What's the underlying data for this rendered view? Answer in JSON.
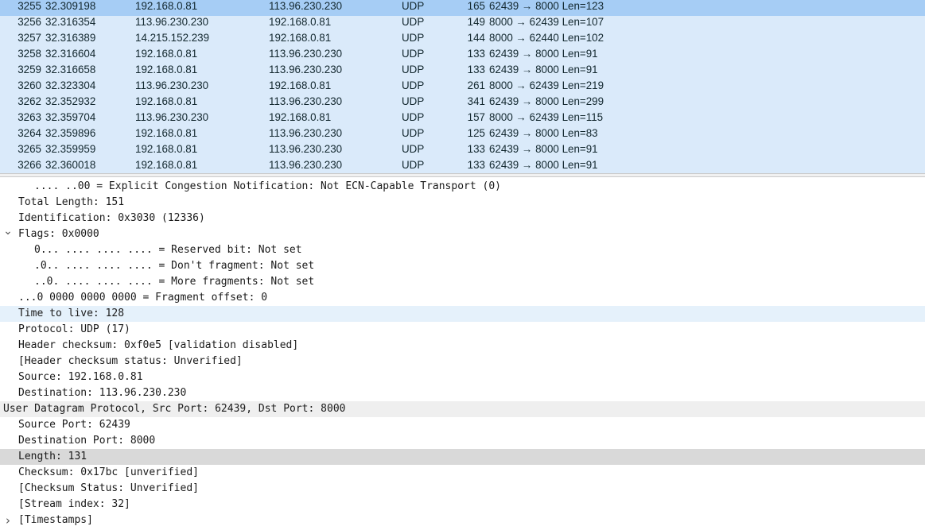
{
  "packet_list": {
    "rows": [
      {
        "no": "3255",
        "time": "32.309198",
        "src": "192.168.0.81",
        "dst": "113.96.230.230",
        "proto": "UDP",
        "len": "165",
        "info": "62439 → 8000 Len=123",
        "selected": true
      },
      {
        "no": "3256",
        "time": "32.316354",
        "src": "113.96.230.230",
        "dst": "192.168.0.81",
        "proto": "UDP",
        "len": "149",
        "info": "8000 → 62439 Len=107",
        "selected": false
      },
      {
        "no": "3257",
        "time": "32.316389",
        "src": "14.215.152.239",
        "dst": "192.168.0.81",
        "proto": "UDP",
        "len": "144",
        "info": "8000 → 62440 Len=102",
        "selected": false
      },
      {
        "no": "3258",
        "time": "32.316604",
        "src": "192.168.0.81",
        "dst": "113.96.230.230",
        "proto": "UDP",
        "len": "133",
        "info": "62439 → 8000 Len=91",
        "selected": false
      },
      {
        "no": "3259",
        "time": "32.316658",
        "src": "192.168.0.81",
        "dst": "113.96.230.230",
        "proto": "UDP",
        "len": "133",
        "info": "62439 → 8000 Len=91",
        "selected": false
      },
      {
        "no": "3260",
        "time": "32.323304",
        "src": "113.96.230.230",
        "dst": "192.168.0.81",
        "proto": "UDP",
        "len": "261",
        "info": "8000 → 62439 Len=219",
        "selected": false
      },
      {
        "no": "3262",
        "time": "32.352932",
        "src": "192.168.0.81",
        "dst": "113.96.230.230",
        "proto": "UDP",
        "len": "341",
        "info": "62439 → 8000 Len=299",
        "selected": false
      },
      {
        "no": "3263",
        "time": "32.359704",
        "src": "113.96.230.230",
        "dst": "192.168.0.81",
        "proto": "UDP",
        "len": "157",
        "info": "8000 → 62439 Len=115",
        "selected": false
      },
      {
        "no": "3264",
        "time": "32.359896",
        "src": "192.168.0.81",
        "dst": "113.96.230.230",
        "proto": "UDP",
        "len": "125",
        "info": "62439 → 8000 Len=83",
        "selected": false
      },
      {
        "no": "3265",
        "time": "32.359959",
        "src": "192.168.0.81",
        "dst": "113.96.230.230",
        "proto": "UDP",
        "len": "133",
        "info": "62439 → 8000 Len=91",
        "selected": false
      },
      {
        "no": "3266",
        "time": "32.360018",
        "src": "192.168.0.81",
        "dst": "113.96.230.230",
        "proto": "UDP",
        "len": "133",
        "info": "62439 → 8000 Len=91",
        "selected": false
      }
    ]
  },
  "details": {
    "rows": [
      {
        "text": ".... ..00 = Explicit Congestion Notification: Not ECN-Capable Transport (0)",
        "indent": 2,
        "toggle": "",
        "highlight": ""
      },
      {
        "text": "Total Length: 151",
        "indent": 1,
        "toggle": "",
        "highlight": ""
      },
      {
        "text": "Identification: 0x3030 (12336)",
        "indent": 1,
        "toggle": "",
        "highlight": ""
      },
      {
        "text": "Flags: 0x0000",
        "indent": 1,
        "toggle": "expanded",
        "highlight": ""
      },
      {
        "text": "0... .... .... .... = Reserved bit: Not set",
        "indent": 2,
        "toggle": "",
        "highlight": ""
      },
      {
        "text": ".0.. .... .... .... = Don't fragment: Not set",
        "indent": 2,
        "toggle": "",
        "highlight": ""
      },
      {
        "text": "..0. .... .... .... = More fragments: Not set",
        "indent": 2,
        "toggle": "",
        "highlight": ""
      },
      {
        "text": "...0 0000 0000 0000 = Fragment offset: 0",
        "indent": 1,
        "toggle": "",
        "highlight": ""
      },
      {
        "text": "Time to live: 128",
        "indent": 1,
        "toggle": "",
        "highlight": "blue"
      },
      {
        "text": "Protocol: UDP (17)",
        "indent": 1,
        "toggle": "",
        "highlight": ""
      },
      {
        "text": "Header checksum: 0xf0e5 [validation disabled]",
        "indent": 1,
        "toggle": "",
        "highlight": ""
      },
      {
        "text": "[Header checksum status: Unverified]",
        "indent": 1,
        "toggle": "",
        "highlight": ""
      },
      {
        "text": "Source: 192.168.0.81",
        "indent": 1,
        "toggle": "",
        "highlight": ""
      },
      {
        "text": "Destination: 113.96.230.230",
        "indent": 1,
        "toggle": "",
        "highlight": ""
      },
      {
        "text": "User Datagram Protocol, Src Port: 62439, Dst Port: 8000",
        "indent": 0,
        "toggle": "",
        "highlight": "section"
      },
      {
        "text": "Source Port: 62439",
        "indent": 1,
        "toggle": "",
        "highlight": ""
      },
      {
        "text": "Destination Port: 8000",
        "indent": 1,
        "toggle": "",
        "highlight": ""
      },
      {
        "text": "Length: 131",
        "indent": 1,
        "toggle": "",
        "highlight": "grey"
      },
      {
        "text": "Checksum: 0x17bc [unverified]",
        "indent": 1,
        "toggle": "",
        "highlight": ""
      },
      {
        "text": "[Checksum Status: Unverified]",
        "indent": 1,
        "toggle": "",
        "highlight": ""
      },
      {
        "text": "[Stream index: 32]",
        "indent": 1,
        "toggle": "",
        "highlight": ""
      },
      {
        "text": "[Timestamps]",
        "indent": 1,
        "toggle": "collapsed",
        "highlight": ""
      }
    ]
  },
  "icons": {
    "expanded": "chevron-down-icon",
    "collapsed": "chevron-right-icon"
  }
}
